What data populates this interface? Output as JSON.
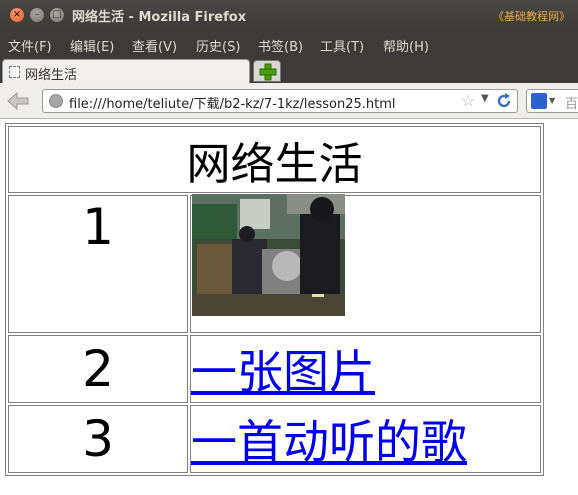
{
  "window": {
    "title": "网络生活 - Mozilla Firefox",
    "watermark": "《基础教程网》"
  },
  "menu": {
    "items": [
      "文件(F)",
      "编辑(E)",
      "查看(V)",
      "历史(S)",
      "书签(B)",
      "工具(T)",
      "帮助(H)"
    ]
  },
  "tab": {
    "label": "网络生活"
  },
  "navbar": {
    "url": "file:///home/teliute/下载/b2-kz/7-1kz/lesson25.html",
    "search_text": "百"
  },
  "page": {
    "heading": "网络生活",
    "rows": [
      {
        "num": "1",
        "content_type": "image"
      },
      {
        "num": "2",
        "link_text": "一张图片"
      },
      {
        "num": "3",
        "link_text": "一首动听的歌"
      }
    ]
  },
  "icons": {
    "close": "close-icon",
    "minimize": "minimize-icon",
    "maximize": "maximize-icon",
    "back": "back-arrow-icon",
    "globe": "globe-icon",
    "star": "bookmark-star-icon",
    "reload": "reload-icon",
    "new_tab": "plus-icon",
    "search_engine": "baidu-icon"
  }
}
